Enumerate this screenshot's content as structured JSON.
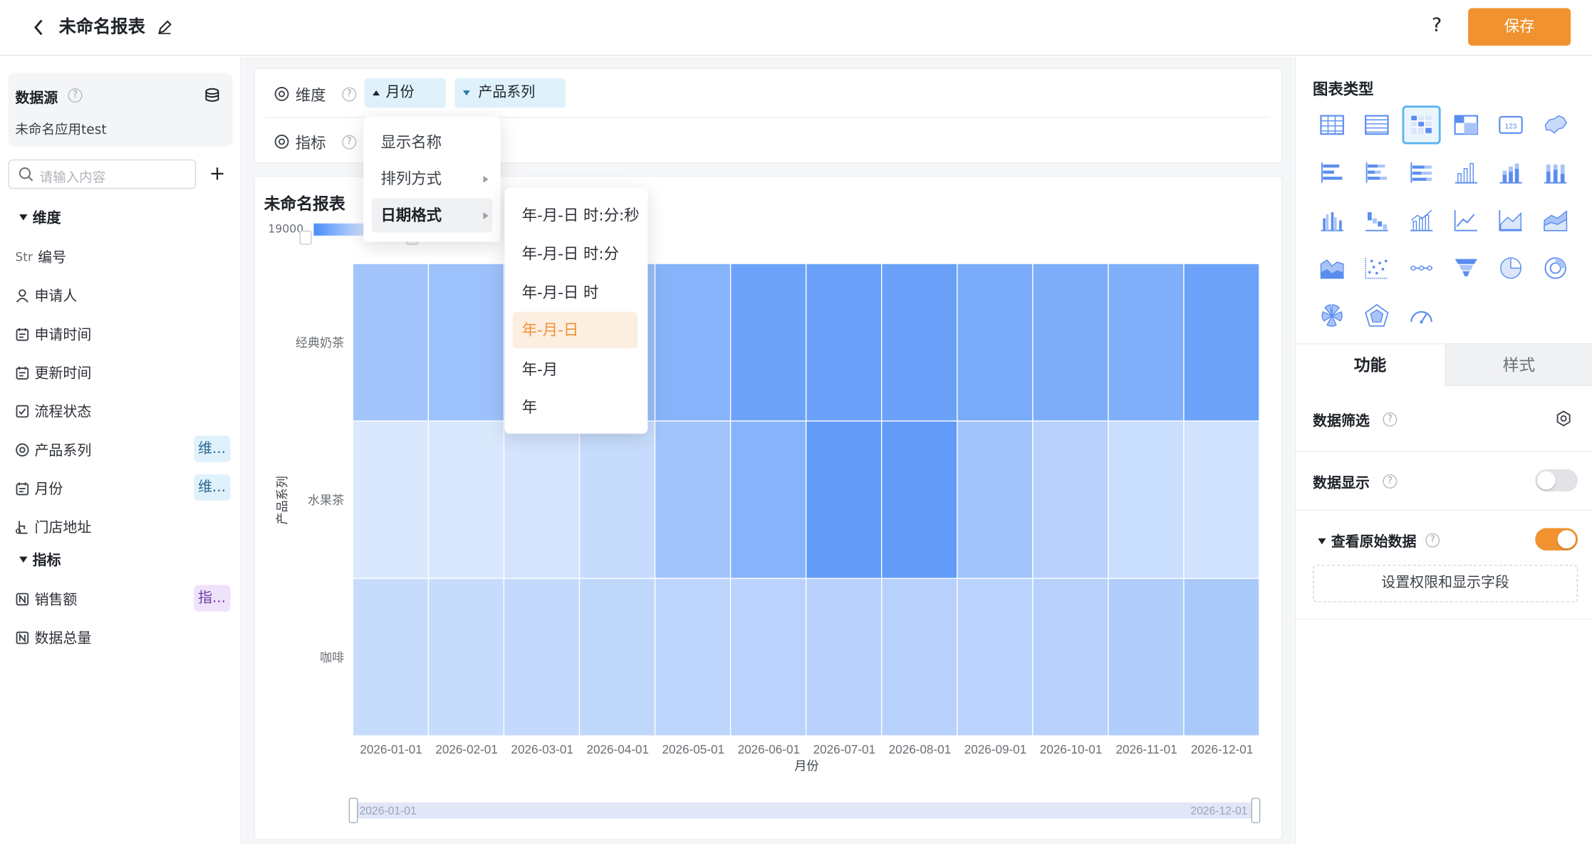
{
  "header": {
    "title": "未命名报表",
    "help": "?",
    "save_label": "保存"
  },
  "left": {
    "datasource": {
      "title": "数据源",
      "app": "未命名应用test"
    },
    "search": {
      "placeholder": "请输入内容"
    },
    "sections": {
      "dimension": "维度",
      "measure": "指标"
    },
    "fields": [
      {
        "prefix": "Str",
        "label": "编号"
      },
      {
        "label": "申请人"
      },
      {
        "label": "申请时间"
      },
      {
        "label": "更新时间"
      },
      {
        "label": "流程状态"
      },
      {
        "label": "产品系列",
        "tag": "维..."
      },
      {
        "label": "月份",
        "tag": "维..."
      },
      {
        "label": "门店地址"
      }
    ],
    "measures": [
      {
        "label": "销售额",
        "tag": "指..."
      },
      {
        "label": "数据总量"
      }
    ]
  },
  "center": {
    "dimension_label": "维度",
    "measure_label": "指标",
    "chips": [
      "月份",
      "产品系列"
    ],
    "chart_title": "未命名报表",
    "legend_value": "19000"
  },
  "menu": {
    "items": [
      "显示名称",
      "排列方式",
      "日期格式"
    ],
    "date_formats": [
      "年-月-日 时:分:秒",
      "年-月-日 时:分",
      "年-月-日 时",
      "年-月-日",
      "年-月",
      "年"
    ],
    "selected": "年-月-日"
  },
  "chart_data": {
    "type": "heatmap",
    "title": "",
    "x": [
      "2026-01-01",
      "2026-02-01",
      "2026-03-01",
      "2026-04-01",
      "2026-05-01",
      "2026-06-01",
      "2026-07-01",
      "2026-08-01",
      "2026-09-01",
      "2026-10-01",
      "2026-11-01",
      "2026-12-01"
    ],
    "y": [
      "经典奶茶",
      "水果茶",
      "咖啡"
    ],
    "xlabel": "月份",
    "ylabel": "产品系列",
    "values": [
      [
        0.45,
        0.48,
        0.5,
        0.52,
        0.62,
        0.78,
        0.8,
        0.8,
        0.7,
        0.68,
        0.66,
        0.78
      ],
      [
        0.1,
        0.1,
        0.14,
        0.22,
        0.45,
        0.62,
        0.85,
        0.85,
        0.45,
        0.32,
        0.2,
        0.16
      ],
      [
        0.22,
        0.22,
        0.24,
        0.26,
        0.28,
        0.3,
        0.32,
        0.32,
        0.3,
        0.32,
        0.36,
        0.4
      ]
    ],
    "colors": {
      "low": "#eaf2fe",
      "high": "#4a8cf7"
    },
    "zoom": {
      "start": "2026-01-01",
      "end": "2026-12-01"
    }
  },
  "right": {
    "chart_type_title": "图表类型",
    "tabs": [
      "功能",
      "样式"
    ],
    "filter_label": "数据筛选",
    "display_label": "数据显示",
    "raw_label": "查看原始数据",
    "raw_button": "设置权限和显示字段",
    "display_on": false,
    "raw_on": true,
    "accent": "#f0922f"
  }
}
